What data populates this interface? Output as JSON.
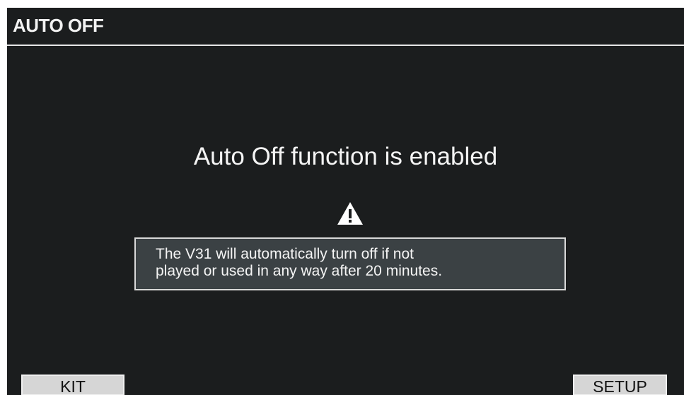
{
  "header": {
    "title": "AUTO OFF"
  },
  "main": {
    "message": "Auto Off function is enabled",
    "warning_icon": "warning-triangle-icon",
    "info_line1": "The V31 will automatically turn off if not",
    "info_line2": "played or used in any way after 20 minutes."
  },
  "softkeys": {
    "left_label": "KIT",
    "right_label": "SETUP"
  },
  "colors": {
    "background": "#1b1d1e",
    "info_box": "#3b4144",
    "text": "#f4f4f4",
    "softkey": "#d6d6d6"
  }
}
